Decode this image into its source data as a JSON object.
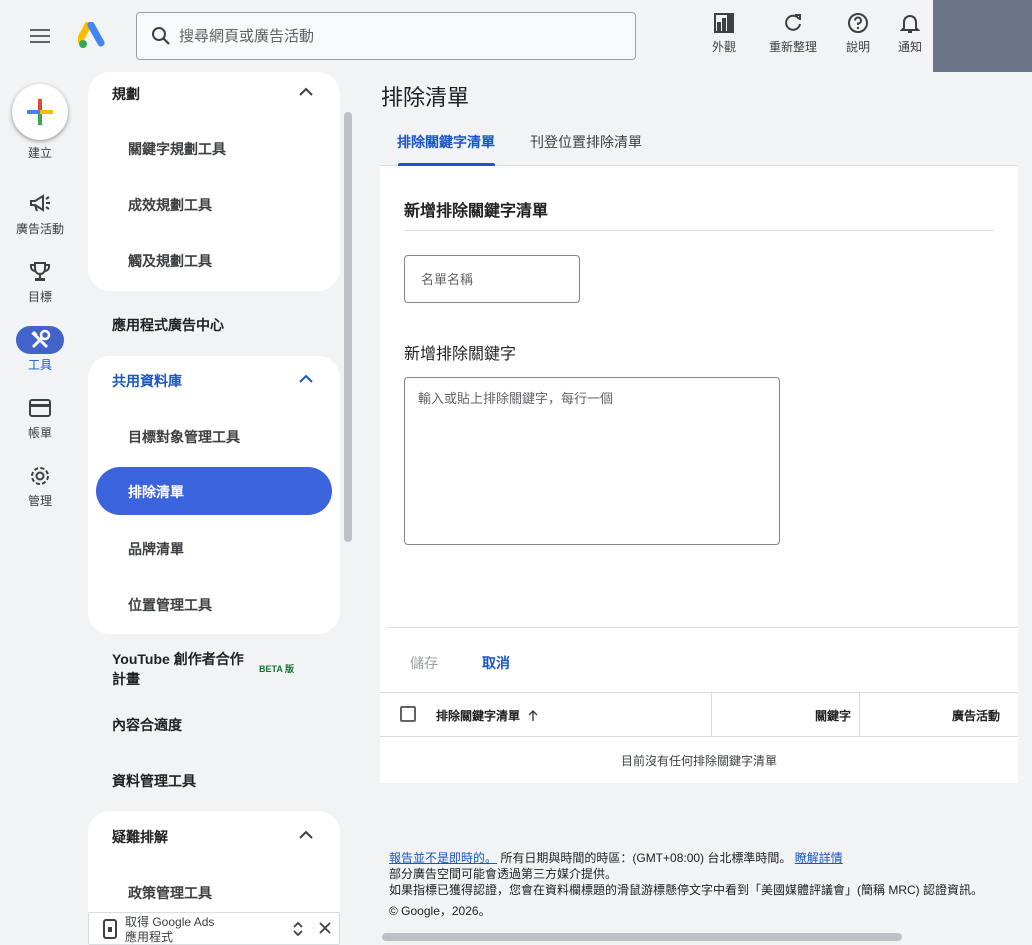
{
  "header": {
    "search_placeholder": "搜尋網頁或廣告活動",
    "actions": [
      {
        "label": "外觀",
        "icon": "appearance-icon"
      },
      {
        "label": "重新整理",
        "icon": "refresh-icon"
      },
      {
        "label": "說明",
        "icon": "help-icon"
      },
      {
        "label": "通知",
        "icon": "bell-icon"
      }
    ]
  },
  "rail": {
    "create_label": "建立",
    "items": [
      {
        "label": "廣告活動",
        "icon": "megaphone-icon"
      },
      {
        "label": "目標",
        "icon": "trophy-icon"
      },
      {
        "label": "工具",
        "icon": "tools-icon",
        "active": true
      },
      {
        "label": "帳單",
        "icon": "credit-card-icon"
      },
      {
        "label": "管理",
        "icon": "gear-icon"
      }
    ]
  },
  "sidenav": {
    "planning": {
      "title": "規劃",
      "items": [
        "關鍵字規劃工具",
        "成效規劃工具",
        "觸及規劃工具"
      ]
    },
    "app_center": "應用程式廣告中心",
    "shared_library": {
      "title": "共用資料庫",
      "items": [
        "目標對象管理工具",
        "排除清單",
        "品牌清單",
        "位置管理工具"
      ]
    },
    "youtube_line1": "YouTube 創作者合作",
    "youtube_line2": "計畫",
    "beta": "BETA 版",
    "content_suitability": "內容合適度",
    "data_manager": "資料管理工具",
    "troubleshoot": {
      "title": "疑難排解",
      "items": [
        "政策管理工具"
      ]
    },
    "app_promo_line1": "取得 Google Ads",
    "app_promo_line2": "應用程式"
  },
  "main": {
    "page_title": "排除清單",
    "tabs": [
      "排除關鍵字清單",
      "刊登位置排除清單"
    ],
    "form": {
      "title": "新增排除關鍵字清單",
      "name_placeholder": "名單名稱",
      "keywords_title": "新增排除關鍵字",
      "keywords_placeholder": "輸入或貼上排除關鍵字，每行一個",
      "save": "儲存",
      "cancel": "取消"
    },
    "table": {
      "columns": [
        "排除關鍵字清單",
        "關鍵字",
        "廣告活動"
      ],
      "empty": "目前沒有任何排除關鍵字清單"
    }
  },
  "footer": {
    "link1": "報告並不是即時的。",
    "text1": "所有日期與時間的時區：(GMT+08:00) 台北標準時間。",
    "link2": "瞭解詳情",
    "line2": "部分廣告空間可能會透過第三方媒介提供。",
    "line3": "如果指標已獲得認證，您會在資料欄標題的滑鼠游標懸停文字中看到「美國媒體評議會」(簡稱 MRC) 認證資訊。",
    "copyright": "© Google，2026。"
  },
  "colors": {
    "accent": "#1a56c4",
    "active_nav": "#3b63db",
    "background": "#f1f3f4"
  }
}
